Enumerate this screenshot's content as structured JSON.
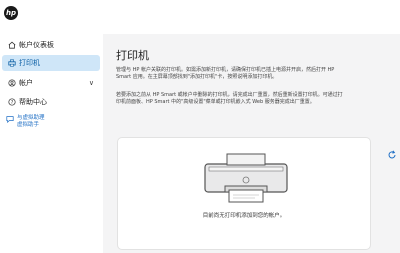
{
  "header": {
    "logo_text": "hp"
  },
  "sidebar": {
    "items": [
      {
        "label": "帐户仪表板",
        "icon": "home-icon"
      },
      {
        "label": "打印机",
        "icon": "printer-icon",
        "active": true
      },
      {
        "label": "帐户",
        "icon": "person-icon"
      },
      {
        "label": "帮助中心",
        "icon": "help-icon"
      }
    ],
    "account_caret": "∨",
    "assistant": {
      "line1": "与虚拟助理",
      "line2": "虚拟助手",
      "icon": "chat-icon"
    }
  },
  "main": {
    "title": "打印机",
    "para1_line1": "管理与 HP 帐户关联的打印机。如需添加新打印机，请确保打印机已插上电源并开启，然后打开 HP",
    "para1_line2": "Smart 应用。在主屏幕顶部找到\"添加打印机\"卡，按照说明添加打印机。",
    "para2_line1": "若要添加之前从 HP Smart 或帐户中删除的打印机，请完成出厂重置，然后重新设置打印机。可通过打",
    "para2_line2": "印机前面板、HP Smart 中的\"高级设置\"菜单或打印机嵌入式 Web 服务器完成出厂重置。",
    "empty_message": "目前尚无打印机添加到您的帐户。"
  },
  "colors": {
    "active_bg": "#cfe6f8",
    "accent": "#1f6fc5",
    "main_bg": "#f4f4f5"
  }
}
